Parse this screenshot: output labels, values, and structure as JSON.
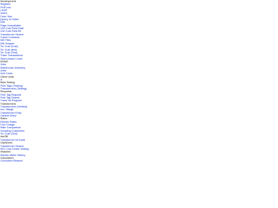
{
  "colors": {
    "link": "#0b2fd4",
    "heading": "#111111",
    "background": "#ffffff"
  },
  "nav": {
    "items": [
      {
        "label": "Development",
        "kind": "heading"
      },
      {
        "label": "Registex",
        "kind": "link"
      },
      {
        "label": "PHP Info",
        "kind": "link"
      },
      {
        "label": "LDAP",
        "kind": "link"
      },
      {
        "label": "Users",
        "kind": "link"
      },
      {
        "label": "Form Test",
        "kind": "link"
      },
      {
        "label": "jQuery UI Index",
        "kind": "link"
      },
      {
        "label": "MIS",
        "kind": "link"
      },
      {
        "label": "Page Unavailable",
        "kind": "link"
      },
      {
        "label": "CW Cust Field Date",
        "kind": "link"
      },
      {
        "label": "CW Cust Field Kit",
        "kind": "link"
      },
      {
        "label": "Transformer Search",
        "kind": "link"
      },
      {
        "label": "Travel Contracts",
        "kind": "link"
      },
      {
        "label": "MH Files",
        "kind": "link"
      },
      {
        "label": "MN Scraper",
        "kind": "link"
      },
      {
        "label": "Tcr Cust (Cust)",
        "kind": "link"
      },
      {
        "label": "Tcr Cust (test)",
        "kind": "link"
      },
      {
        "label": "Tcr Cust (Test)",
        "kind": "link"
      },
      {
        "label": "Trans Transactions",
        "kind": "link"
      },
      {
        "label": "Storm Asset Count",
        "kind": "link"
      },
      {
        "label": "DDMS",
        "kind": "heading"
      },
      {
        "label": "Jobs",
        "kind": "link"
      },
      {
        "label": "Warehouse Inventory",
        "kind": "link"
      },
      {
        "label": "Units",
        "kind": "link"
      },
      {
        "label": "Unit Costs",
        "kind": "link"
      },
      {
        "label": "Client Units",
        "kind": "heading"
      },
      {
        "label": "A",
        "kind": "link"
      },
      {
        "label": "Beta Testing",
        "kind": "heading"
      },
      {
        "label": "Pole Tags (Testing)",
        "kind": "link"
      },
      {
        "label": "Transformers (Testing)",
        "kind": "link"
      },
      {
        "label": "Requests",
        "kind": "heading"
      },
      {
        "label": "Pole Tag Request",
        "kind": "link"
      },
      {
        "label": "Pole Tag Search",
        "kind": "link"
      },
      {
        "label": "Trans No Request",
        "kind": "link"
      },
      {
        "label": "Transformers",
        "kind": "heading"
      },
      {
        "label": "Transformers (Verified)",
        "kind": "link"
      },
      {
        "label": "Ins / Weigh",
        "kind": "link"
      },
      {
        "label": "Transformer Entry",
        "kind": "link"
      },
      {
        "label": "Cabinet Entry",
        "kind": "link"
      },
      {
        "label": "Rates",
        "kind": "heading"
      },
      {
        "label": "Electric Rates",
        "kind": "link"
      },
      {
        "label": "Fuel Charge",
        "kind": "link"
      },
      {
        "label": "Rate Comparison",
        "kind": "link"
      },
      {
        "label": "Tcrasting Customers",
        "kind": "link"
      },
      {
        "label": "Tcr Cust (Test)",
        "kind": "link"
      },
      {
        "label": "AmSB",
        "kind": "heading"
      },
      {
        "label": "Transformer Inf Audit",
        "kind": "link"
      },
      {
        "label": "CityWorks",
        "kind": "heading"
      },
      {
        "label": "Transformer Search",
        "kind": "link"
      },
      {
        "label": "WO Cost Center Testing",
        "kind": "link"
      },
      {
        "label": "Histories",
        "kind": "heading"
      },
      {
        "label": "Electric Meter History",
        "kind": "link"
      },
      {
        "label": "Calculators",
        "kind": "heading"
      },
      {
        "label": "Conductor Blowout",
        "kind": "link"
      }
    ]
  }
}
